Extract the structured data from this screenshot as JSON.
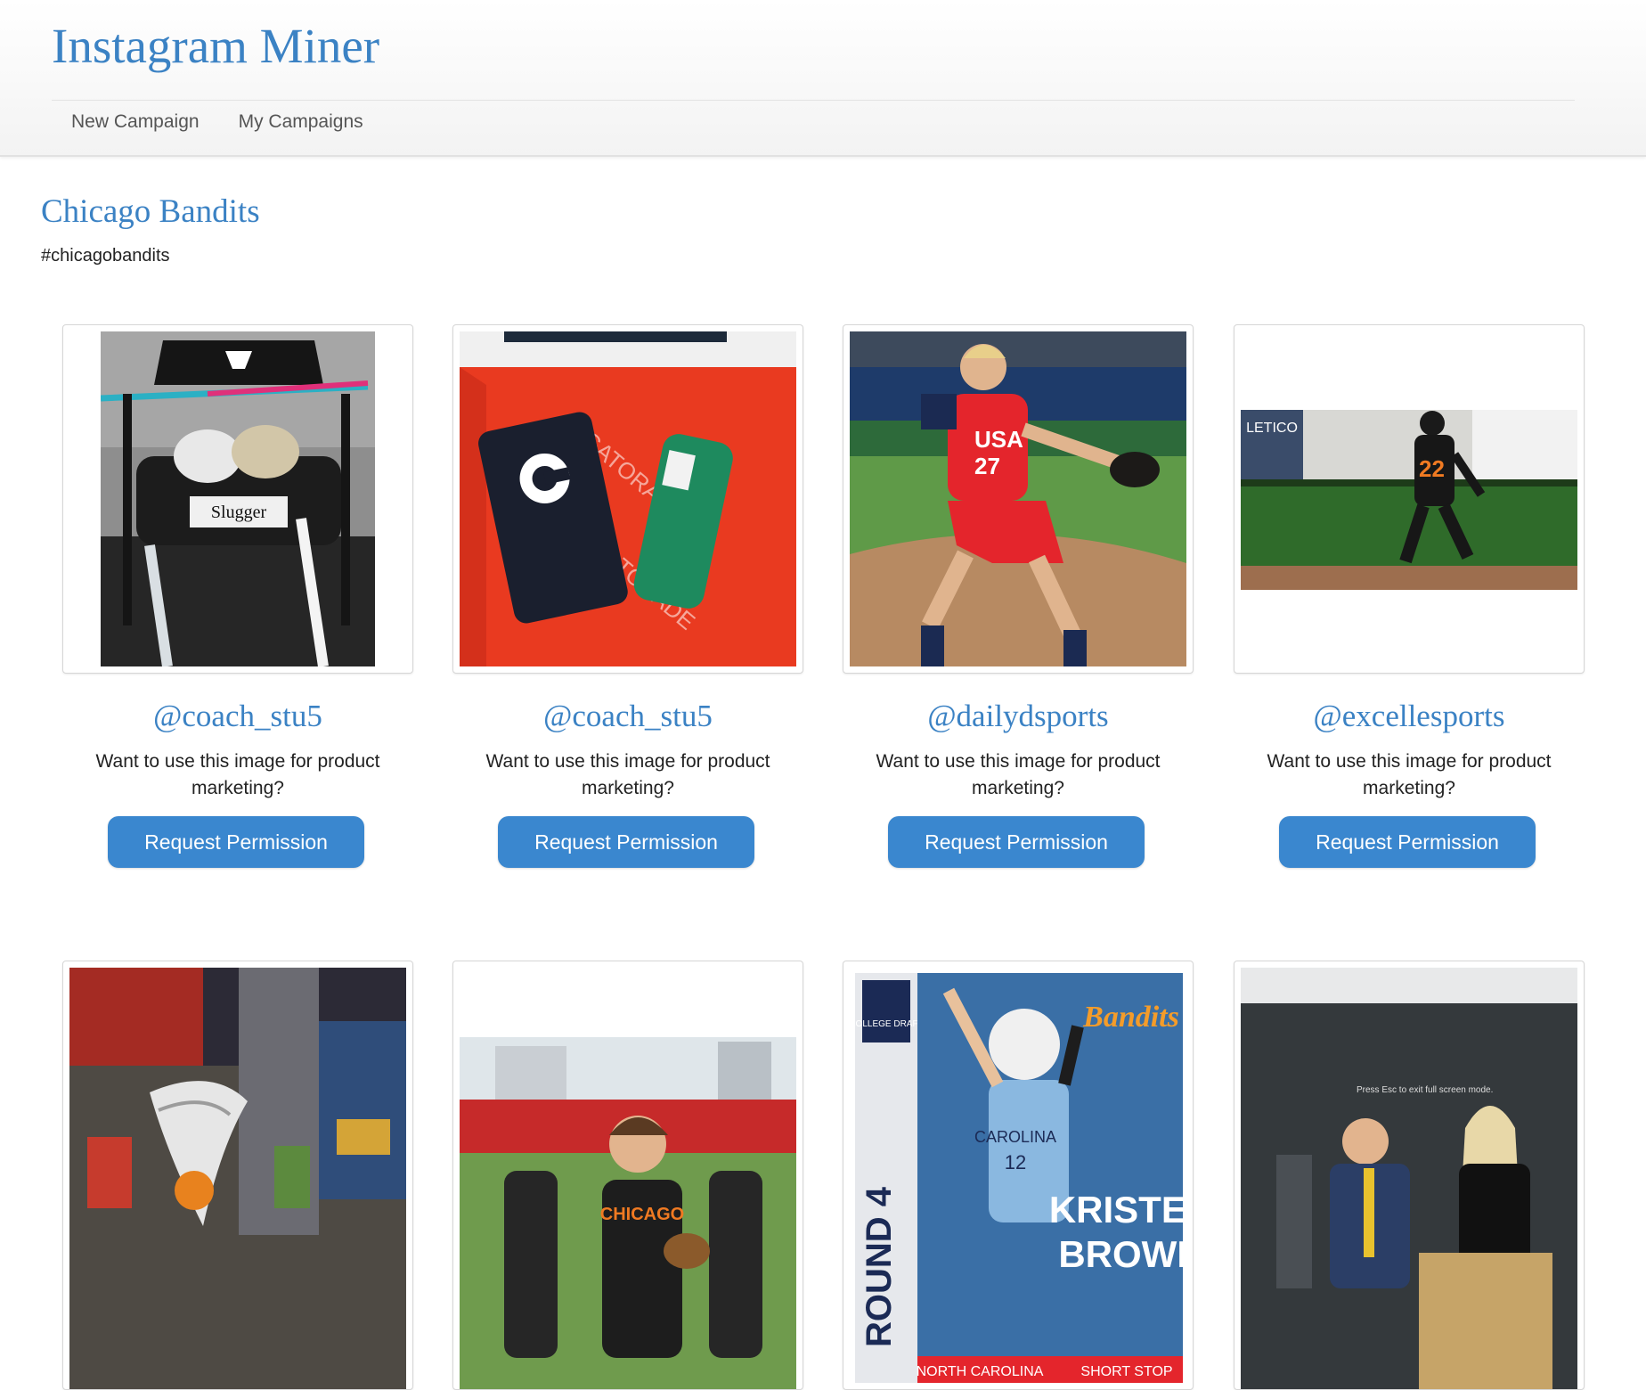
{
  "header": {
    "brand": "Instagram Miner",
    "nav": [
      "New Campaign",
      "My Campaigns"
    ]
  },
  "campaign": {
    "title": "Chicago Bandits",
    "hashtag": "#chicagobandits"
  },
  "posts": [
    {
      "handle": "@coach_stu5",
      "prompt": "Want to use this image for product marketing?",
      "button": "Request Permission"
    },
    {
      "handle": "@coach_stu5",
      "prompt": "Want to use this image for product marketing?",
      "button": "Request Permission"
    },
    {
      "handle": "@dailydsports",
      "prompt": "Want to use this image for product marketing?",
      "button": "Request Permission"
    },
    {
      "handle": "@excellesports",
      "prompt": "Want to use this image for product marketing?",
      "button": "Request Permission"
    }
  ],
  "image_text": {
    "slugger": "Slugger",
    "gatorade": "GATORADE",
    "usa": "USA",
    "jersey_27": "27",
    "jersey_22": "22",
    "banner_1": "LETICO",
    "chicago": "CHICAGO",
    "round": "ROUND 4",
    "bandits": "Bandits",
    "player_first": "KRISTEN",
    "player_last": "BROWN",
    "school_banner": "NORTH CAROLINA",
    "position": "SHORT STOP",
    "jersey_carolina": "CAROLINA",
    "jersey_12": "12",
    "draft_badge": "COLLEGE DRAFT",
    "screen_caption": "Press Esc to exit full screen mode."
  }
}
